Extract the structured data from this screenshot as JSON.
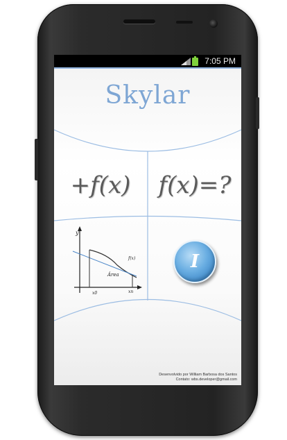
{
  "status": {
    "time": "7:05 PM",
    "signal_icon": "signal-icon",
    "battery_icon": "battery-icon"
  },
  "app": {
    "title": "Skylar",
    "tiles": {
      "derivative": "+f(x)",
      "equation": "f(x)=?",
      "area_graph": {
        "y_label": "y",
        "f_label": "f(x)",
        "area_label": "Área",
        "x0_label": "x0",
        "xn_label": "xn",
        "icon": "area-under-curve-graph-icon"
      },
      "info": "I"
    },
    "footer": {
      "line1": "Desenvolvido por William Barbosa dos Santos",
      "line2": "Contato: wbs.developer@gmail.com"
    }
  },
  "colors": {
    "accent": "#7ea6d4",
    "divider": "#8fb2dd",
    "button": "#4a95d2"
  }
}
